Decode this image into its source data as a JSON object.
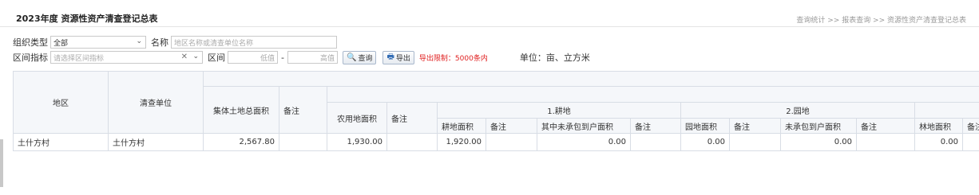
{
  "header": {
    "title": "2023年度 资源性资产清查登记总表",
    "breadcrumb": "查询统计 >> 报表查询 >> 资源性资产清查登记总表"
  },
  "filters": {
    "org_type_label": "组织类型",
    "org_type_value": "全部",
    "name_label": "名称",
    "name_placeholder": "地区名称或清查单位名称",
    "indicator_label": "区间指标",
    "indicator_placeholder": "请选择区间指标",
    "range_label": "区间",
    "range_low_placeholder": "低值",
    "range_sep": "-",
    "range_high_placeholder": "高值",
    "query_button": "查询",
    "export_button": "导出",
    "export_limit": "导出限制：5000条内",
    "unit": "单位：亩、立方米"
  },
  "icons": {
    "query": "magnifier-icon",
    "export": "printer-icon",
    "dropdown": "chevron-down-icon",
    "clear": "clear-icon"
  },
  "table": {
    "headers": {
      "region": "地区",
      "unit": "清查单位",
      "collective_total": "集体土地总面积",
      "remark": "备注",
      "farm_area": "农用地面积",
      "farm_remark": "备注",
      "group_cultivated": "1.耕地",
      "group_garden": "2.园地",
      "cult_area": "耕地面积",
      "cult_remark": "备注",
      "cult_uncontracted": "其中未承包到户面积",
      "cult_uncontracted_remark": "备注",
      "garden_area": "园地面积",
      "garden_remark": "备注",
      "garden_uncontracted": "未承包到户面积",
      "garden_uncontracted_remark": "备注",
      "forest_area": "林地面积",
      "forest_remark": "备注"
    },
    "rows": [
      {
        "region": "土什方村",
        "unit": "土什方村",
        "collective_total": "2,567.80",
        "remark": "",
        "farm_area": "1,930.00",
        "farm_remark": "",
        "cult_area": "1,920.00",
        "cult_remark": "",
        "cult_uncontracted": "0.00",
        "cult_uncontracted_remark": "",
        "garden_area": "0.00",
        "garden_remark": "",
        "garden_uncontracted": "0.00",
        "garden_uncontracted_remark": "",
        "forest_area": "0.00",
        "forest_remark": ""
      }
    ]
  }
}
